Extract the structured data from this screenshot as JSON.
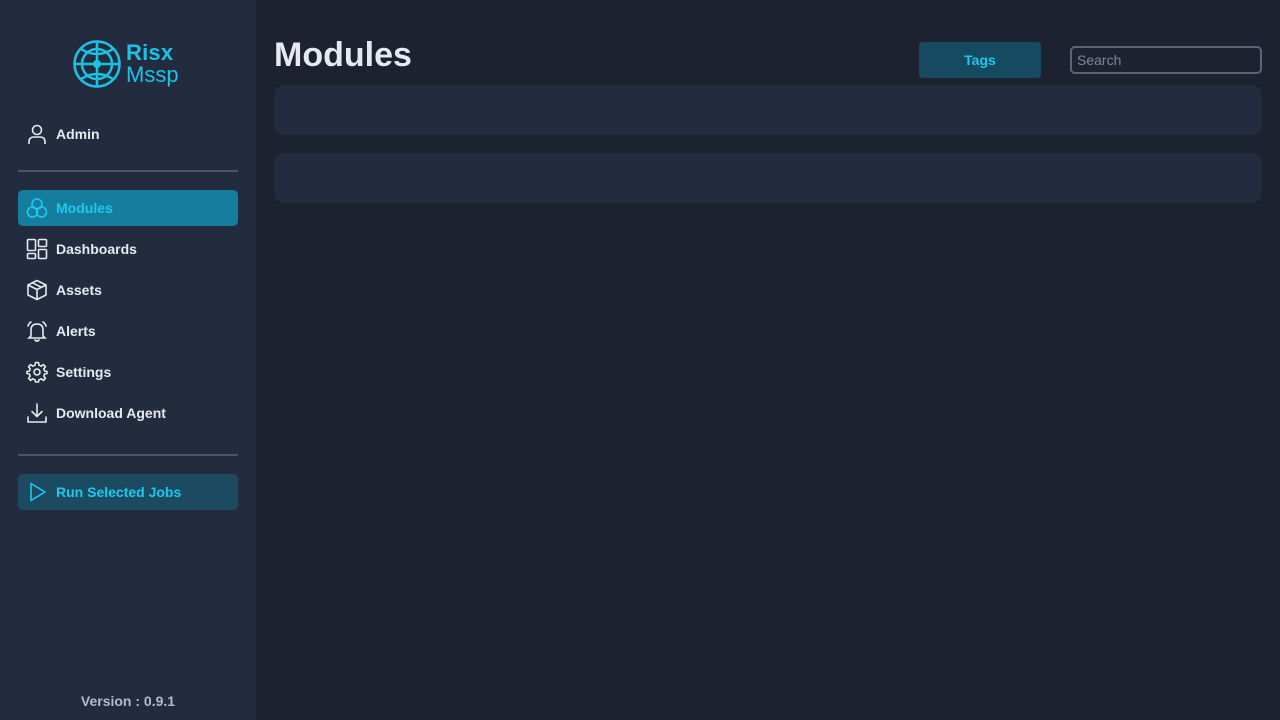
{
  "brand": {
    "line1": "Risx",
    "line2": "Mssp",
    "color": "#19c3e6"
  },
  "user": {
    "label": "Admin",
    "icon": "user-icon"
  },
  "nav": {
    "items": [
      {
        "label": "Modules",
        "icon": "modules-icon",
        "active": true
      },
      {
        "label": "Dashboards",
        "icon": "dashboards-icon"
      },
      {
        "label": "Assets",
        "icon": "box-icon"
      },
      {
        "label": "Alerts",
        "icon": "bell-icon"
      },
      {
        "label": "Settings",
        "icon": "gear-icon"
      },
      {
        "label": "Download Agent",
        "icon": "download-icon"
      }
    ]
  },
  "actions": {
    "run_label": "Run Selected Jobs",
    "icon": "play-icon"
  },
  "footer": {
    "version": "Version : 0.9.1"
  },
  "main": {
    "title": "Modules",
    "tags_label": "Tags",
    "search": {
      "placeholder": "Search",
      "value": ""
    }
  },
  "colors": {
    "accent": "#1ec8ef",
    "active_bg": "#157e9e",
    "sidebar_bg": "#232c3f",
    "page_bg": "#1d2231"
  }
}
